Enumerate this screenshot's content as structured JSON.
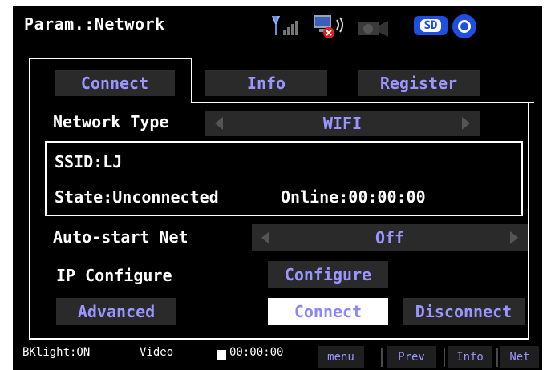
{
  "title": "Param.:Network",
  "icons": {
    "antenna": "antenna-signal-icon",
    "network": "network-muted-icon",
    "camera": "camera-icon",
    "sd": "sd-card-icon",
    "disc": "disc-icon"
  },
  "sd_label": "SD",
  "tabs": [
    "Connect",
    "Info",
    "Register"
  ],
  "network_type": {
    "label": "Network Type",
    "value": "WIFI"
  },
  "ssid": "SSID:LJ",
  "state": "State:Unconnected",
  "online": "Online:00:00:00",
  "auto_start": {
    "label": "Auto-start Net",
    "value": "Off"
  },
  "ip_configure": {
    "label": "IP Configure",
    "button": "Configure"
  },
  "actions": {
    "advanced": "Advanced",
    "connect": "Connect",
    "disconnect": "Disconnect"
  },
  "status_bar": {
    "backlight": "BKlight:ON",
    "mode": "Video",
    "time": "00:00:00",
    "buttons": [
      "menu",
      "Prev",
      "Info",
      "Net"
    ]
  },
  "colors": {
    "accent": "#9a95ff",
    "background": "#000000",
    "button_bg": "#2a2a2a",
    "sd_blue": "#1f4fe0"
  }
}
